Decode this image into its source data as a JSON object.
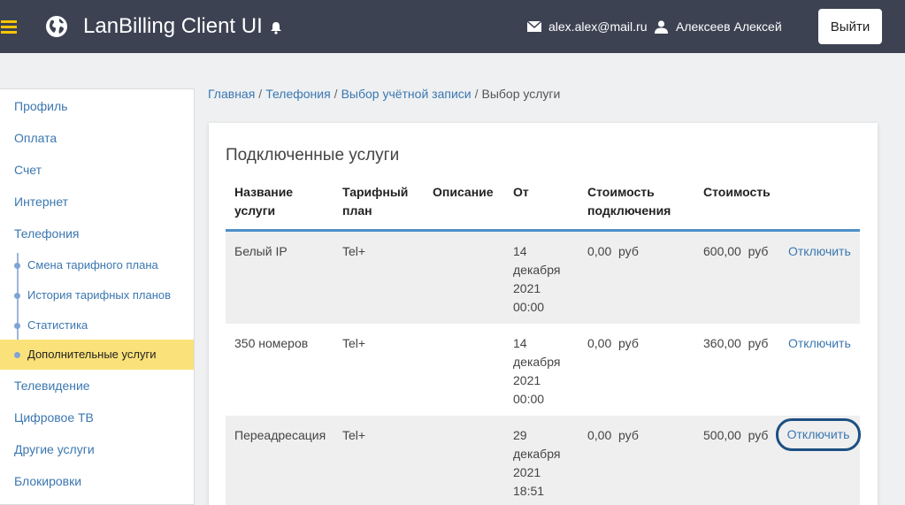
{
  "header": {
    "title": "LanBilling Client UI",
    "email": "alex.alex@mail.ru",
    "user_name": "Алексеев Алексей",
    "logout_label": "Выйти"
  },
  "sidebar": {
    "items": [
      {
        "label": "Профиль"
      },
      {
        "label": "Оплата"
      },
      {
        "label": "Счет"
      },
      {
        "label": "Интернет"
      },
      {
        "label": "Телефония"
      }
    ],
    "sub_items": [
      {
        "label": "Смена тарифного плана"
      },
      {
        "label": "История тарифных планов"
      },
      {
        "label": "Статистика"
      },
      {
        "label": "Дополнительные услуги"
      }
    ],
    "items_after": [
      {
        "label": "Телевидение"
      },
      {
        "label": "Цифровое ТВ"
      },
      {
        "label": "Другие услуги"
      },
      {
        "label": "Блокировки"
      }
    ]
  },
  "breadcrumb": {
    "items": [
      "Главная",
      "Телефония",
      "Выбор учётной записи"
    ],
    "current": "Выбор услуги"
  },
  "main": {
    "card_title": "Подключенные услуги",
    "columns": {
      "name": [
        "Название",
        "услуги"
      ],
      "plan": [
        "Тарифный",
        "план"
      ],
      "desc": "Описание",
      "from": "От",
      "conn_cost": [
        "Стоимость",
        "подключения"
      ],
      "cost": "Стоимость"
    },
    "rows": [
      {
        "name": "Белый IP",
        "plan": "Tel+",
        "desc": "",
        "date": [
          "14",
          "декабря",
          "2021",
          "00:00"
        ],
        "conn_cost": "0,00  руб",
        "cost": "600,00  руб",
        "action": "Отключить"
      },
      {
        "name": "350 номеров",
        "plan": "Tel+",
        "desc": "",
        "date": [
          "14",
          "декабря",
          "2021",
          "00:00"
        ],
        "conn_cost": "0,00  руб",
        "cost": "360,00  руб",
        "action": "Отключить"
      },
      {
        "name": "Переадресация",
        "plan": "Tel+",
        "desc": "",
        "date": [
          "29",
          "декабря",
          "2021",
          "18:51"
        ],
        "conn_cost": "0,00  руб",
        "cost": "500,00  руб",
        "action": "Отключить"
      }
    ]
  },
  "colors": {
    "header_bg": "#3d4253",
    "accent_yellow": "#fbe17a",
    "link": "#3b77b0",
    "table_rule": "#4d90c9"
  }
}
